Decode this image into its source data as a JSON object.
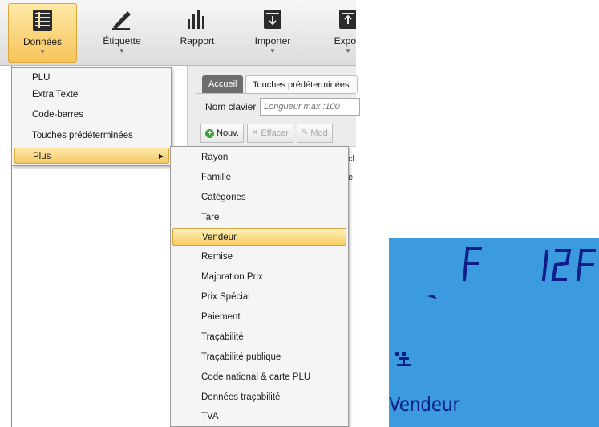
{
  "ribbon": {
    "buttons": [
      {
        "label": "Données",
        "icon": "data-list-icon",
        "active": true
      },
      {
        "label": "Étiquette",
        "icon": "label-pen-icon"
      },
      {
        "label": "Rapport",
        "icon": "report-bars-icon"
      },
      {
        "label": "Importer",
        "icon": "import-icon"
      },
      {
        "label": "Export",
        "icon": "export-icon"
      }
    ]
  },
  "tabs": {
    "home": "Accueil",
    "keys": "Touches prédéterminées"
  },
  "keyboard": {
    "label": "Nom clavier",
    "placeholder": "Longueur max :100"
  },
  "toolbar": {
    "new": "Nouv.",
    "delete": "Effacer",
    "modify": "Mod"
  },
  "cut_text": {
    "first": "cl",
    "second": "e"
  },
  "menu_donnees": {
    "items": [
      "PLU",
      "Extra Texte",
      "Code-barres",
      "Touches prédéterminées",
      "Plus"
    ]
  },
  "menu_plus": {
    "items": [
      "Rayon",
      "Famille",
      "Catégories",
      "Tare",
      "Vendeur",
      "Remise",
      "Majoration Prix",
      "Prix Spécial",
      "Paiement",
      "Traçabilité",
      "Traçabilité publique",
      "Code national & carte PLU",
      "Données traçabilité",
      "TVA"
    ],
    "highlighted": "Vendeur"
  },
  "lcd": {
    "bg_color": "#3c9bde",
    "segment_color": "#0d1d8a",
    "label": "Vendeur"
  },
  "colors": {
    "highlight": "#f7c45a",
    "menu_bg": "#f5f5f5"
  }
}
